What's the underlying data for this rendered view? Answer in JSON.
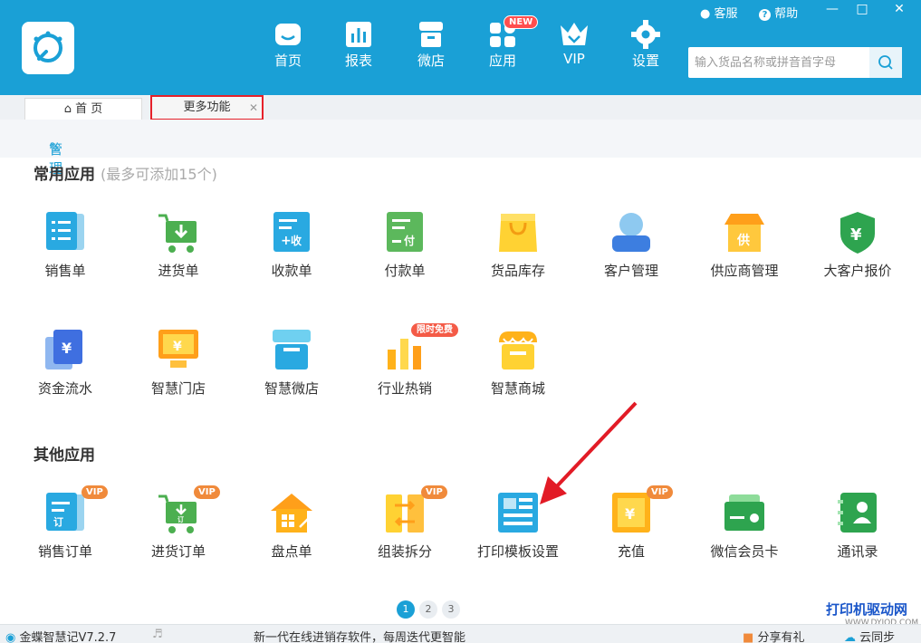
{
  "header": {
    "nav": [
      {
        "label": "首页",
        "icon": "home-icon"
      },
      {
        "label": "报表",
        "icon": "chart-icon"
      },
      {
        "label": "微店",
        "icon": "shop-icon"
      },
      {
        "label": "应用",
        "icon": "apps-icon",
        "badge": "NEW"
      },
      {
        "label": "VIP",
        "icon": "crown-icon"
      },
      {
        "label": "设置",
        "icon": "gear-icon"
      }
    ],
    "customer_service": "客服",
    "help": "帮助",
    "search_placeholder": "输入货品名称或拼音首字母"
  },
  "tabs": {
    "home": "首 页",
    "more": "更多功能"
  },
  "manage_label": "管理",
  "common": {
    "title": "常用应用",
    "subtitle": "(最多可添加15个)",
    "apps": [
      {
        "label": "销售单",
        "icon": "sales-order-icon"
      },
      {
        "label": "进货单",
        "icon": "purchase-cart-icon"
      },
      {
        "label": "收款单",
        "icon": "receipt-icon"
      },
      {
        "label": "付款单",
        "icon": "payment-icon"
      },
      {
        "label": "货品库存",
        "icon": "inventory-bag-icon"
      },
      {
        "label": "客户管理",
        "icon": "customer-icon"
      },
      {
        "label": "供应商管理",
        "icon": "supplier-icon"
      },
      {
        "label": "大客户报价",
        "icon": "vip-quote-icon"
      },
      {
        "label": "资金流水",
        "icon": "cash-flow-icon"
      },
      {
        "label": "智慧门店",
        "icon": "smart-store-icon"
      },
      {
        "label": "智慧微店",
        "icon": "smart-microshop-icon"
      },
      {
        "label": "行业热销",
        "icon": "hot-sales-icon",
        "badge": "限时免费"
      },
      {
        "label": "智慧商城",
        "icon": "smart-mall-icon"
      }
    ]
  },
  "other": {
    "title": "其他应用",
    "vip_badge": "VIP",
    "apps": [
      {
        "label": "销售订单",
        "icon": "sales-order-doc-icon",
        "badge": "VIP"
      },
      {
        "label": "进货订单",
        "icon": "purchase-order-cart-icon",
        "badge": "VIP"
      },
      {
        "label": "盘点单",
        "icon": "stocktake-house-icon"
      },
      {
        "label": "组装拆分",
        "icon": "assemble-split-icon",
        "badge": "VIP"
      },
      {
        "label": "打印模板设置",
        "icon": "print-template-icon"
      },
      {
        "label": "充值",
        "icon": "recharge-icon",
        "badge": "VIP"
      },
      {
        "label": "微信会员卡",
        "icon": "wechat-card-icon"
      },
      {
        "label": "通讯录",
        "icon": "contacts-icon"
      }
    ]
  },
  "pagination": [
    "1",
    "2",
    "3"
  ],
  "status": {
    "version": "金蝶智慧记V7.2.7",
    "slogan": "新一代在线进销存软件，每周迭代更智能",
    "share": "分享有礼",
    "sync": "云同步"
  },
  "watermark": {
    "main": "打印机驱动网",
    "url": "WWW.DYJQD.COM"
  },
  "colors": {
    "brand": "#1aa0d6",
    "highlight_red": "#e6212a"
  }
}
